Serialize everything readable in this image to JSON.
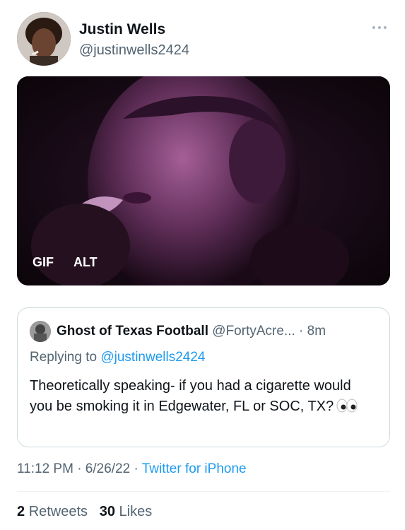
{
  "tweet": {
    "author_name": "Justin Wells",
    "author_handle": "@justinwells2424",
    "more_icon": "more-dots-icon",
    "media": {
      "badge_gif": "GIF",
      "badge_alt": "ALT"
    },
    "quote": {
      "author_name": "Ghost of Texas Football",
      "author_handle": "@FortyAcre...",
      "separator": "·",
      "time": "8m",
      "replying_prefix": "Replying to",
      "replying_to": "@justinwells2424",
      "text": "Theoretically speaking- if you had a cigarette would you be smoking it in Edgewater, FL or SOC, TX?",
      "emoji_icon": "eyes-emoji-icon"
    },
    "timestamp": "11:12 PM · 6/26/22 ·",
    "source": "Twitter for iPhone",
    "retweets_count": "2",
    "retweets_label": "Retweets",
    "likes_count": "30",
    "likes_label": "Likes"
  },
  "colors": {
    "link_blue": "#1d9bf0",
    "secondary_text": "#536471",
    "primary_text": "#0f1419",
    "border": "#cfd9de"
  }
}
